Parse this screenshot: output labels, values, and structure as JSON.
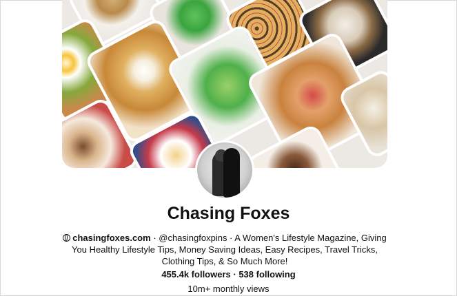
{
  "profile": {
    "name": "Chasing Foxes",
    "website": "chasingfoxes.com",
    "handle_and_bio": "· @chasingfoxpins · A Women's Lifestyle Magazine, Giving You Healthy Lifestyle Tips, Money Saving Ideas, Easy Recipes, Travel Tricks, Clothing Tips, & So Much More!",
    "followers": "455.4k followers",
    "separator": " · ",
    "following": "538 following",
    "monthly_views": "10m+ monthly views"
  },
  "icons": {
    "website": "globe-icon",
    "avatar": "profile-photo-couple"
  },
  "cover_tiles": [
    "food-tile-pancakes-plate",
    "food-tile-green-pancakes-small",
    "food-tile-chocolate-chip-bars",
    "food-tile-granola-bowl",
    "food-tile-avocado-toast-eggs",
    "food-tile-pancakes-syrup",
    "food-tile-green-pancakes-stack",
    "food-tile-french-toast-bake",
    "food-tile-side-dish",
    "food-tile-yogurt-parfait",
    "food-tile-breakfast-table",
    "food-tile-cake-slice"
  ]
}
